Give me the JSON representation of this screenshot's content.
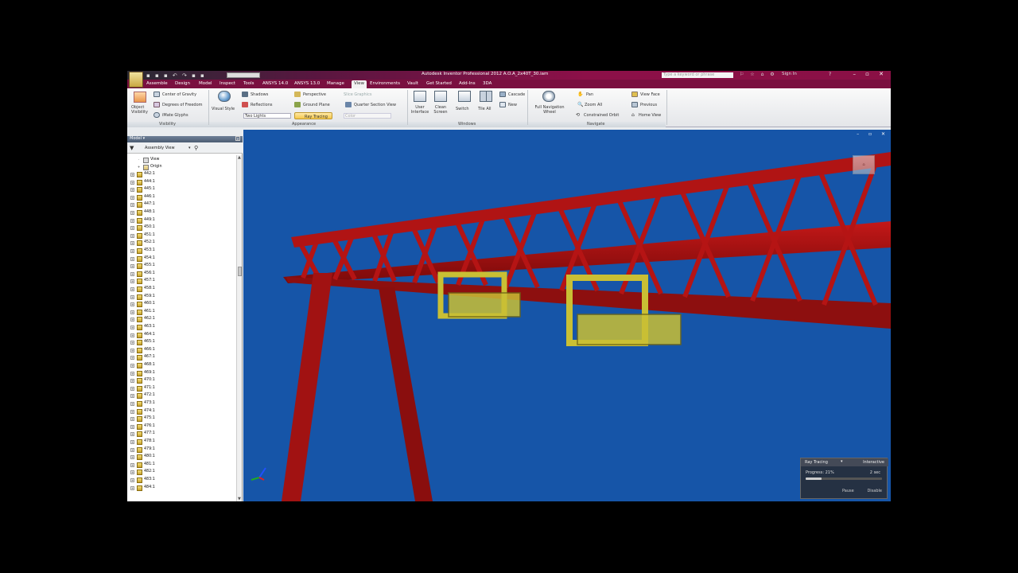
{
  "app": {
    "title": "Autodesk Inventor Professional 2012   A.O.A_2x40T_30.iam",
    "search_placeholder": "Type a keyword or phrase",
    "sign_in": "Sign In",
    "qat_value": "Color",
    "colors": {
      "title_accent": "#8c1048",
      "viewport_bg": "#1655a8",
      "girder": "#a01010",
      "trolley": "#b9b02a"
    }
  },
  "tabs": [
    {
      "label": "Assemble"
    },
    {
      "label": "Design"
    },
    {
      "label": "Model"
    },
    {
      "label": "Inspect"
    },
    {
      "label": "Tools"
    },
    {
      "label": "ANSYS 14.0"
    },
    {
      "label": "ANSYS 13.0"
    },
    {
      "label": "Manage"
    },
    {
      "label": "View"
    },
    {
      "label": "Environments"
    },
    {
      "label": "Vault"
    },
    {
      "label": "Get Started"
    },
    {
      "label": "Add-Ins"
    },
    {
      "label": "3DA"
    }
  ],
  "ribbon": {
    "visibility": {
      "object_visibility": "Object Visibility",
      "center_of_gravity": "Center of Gravity",
      "degrees_of_freedom": "Degrees of Freedom",
      "imate_glyphs": "iMate Glyphs",
      "panel_title": "Visibility"
    },
    "appearance": {
      "visual_style": "Visual Style",
      "shadows": "Shadows",
      "reflections": "Reflections",
      "lighting": "Two Lights",
      "perspective": "Perspective",
      "ground_plane": "Ground Plane",
      "ray_tracing": "Ray Tracing",
      "slice_graphics": "Slice Graphics",
      "quarter_section_view": "Quarter Section View",
      "color": "Color",
      "panel_title": "Appearance"
    },
    "windows": {
      "user_interface": "User Interface",
      "clean_screen": "Clean Screen",
      "switch": "Switch",
      "tile_all": "Tile All",
      "cascade": "Cascade",
      "new": "New",
      "panel_title": "Windows"
    },
    "navigate": {
      "full_navigation_wheel": "Full Navigation Wheel",
      "pan": "Pan",
      "zoom_all": "Zoom All",
      "constrained_orbit": "Constrained Orbit",
      "view_face": "View Face",
      "previous": "Previous",
      "home_view": "Home View",
      "panel_title": "Navigate"
    }
  },
  "browser": {
    "title": "Model",
    "view_mode": "Assembly View",
    "root_items": [
      {
        "label": "View"
      },
      {
        "label": "Origin"
      }
    ],
    "items": [
      {
        "label": "442:1"
      },
      {
        "label": "444:1"
      },
      {
        "label": "445:1"
      },
      {
        "label": "446:1"
      },
      {
        "label": "447:1"
      },
      {
        "label": "448:1"
      },
      {
        "label": "449:1"
      },
      {
        "label": "450:1"
      },
      {
        "label": "451:1"
      },
      {
        "label": "452:1"
      },
      {
        "label": "453:1"
      },
      {
        "label": "454:1"
      },
      {
        "label": "455:1"
      },
      {
        "label": "456:1"
      },
      {
        "label": "457:1"
      },
      {
        "label": "458:1"
      },
      {
        "label": "459:1"
      },
      {
        "label": "460:1"
      },
      {
        "label": "461:1"
      },
      {
        "label": "462:1"
      },
      {
        "label": "463:1"
      },
      {
        "label": "464:1"
      },
      {
        "label": "465:1"
      },
      {
        "label": "466:1"
      },
      {
        "label": "467:1"
      },
      {
        "label": "468:1"
      },
      {
        "label": "469:1"
      },
      {
        "label": "470:1"
      },
      {
        "label": "471:1"
      },
      {
        "label": "472:1"
      },
      {
        "label": "473:1"
      },
      {
        "label": "474:1"
      },
      {
        "label": "475:1"
      },
      {
        "label": "476:1"
      },
      {
        "label": "477:1"
      },
      {
        "label": "478:1"
      },
      {
        "label": "479:1"
      },
      {
        "label": "480:1"
      },
      {
        "label": "481:1"
      },
      {
        "label": "482:1"
      },
      {
        "label": "483:1"
      },
      {
        "label": "484:1"
      }
    ]
  },
  "ray_tracing": {
    "title": "Ray Tracing",
    "mode": "Interactive",
    "progress_label": "Progress: 21%",
    "progress": 0.21,
    "time": "2 sec",
    "pause": "Pause",
    "disable": "Disable"
  }
}
